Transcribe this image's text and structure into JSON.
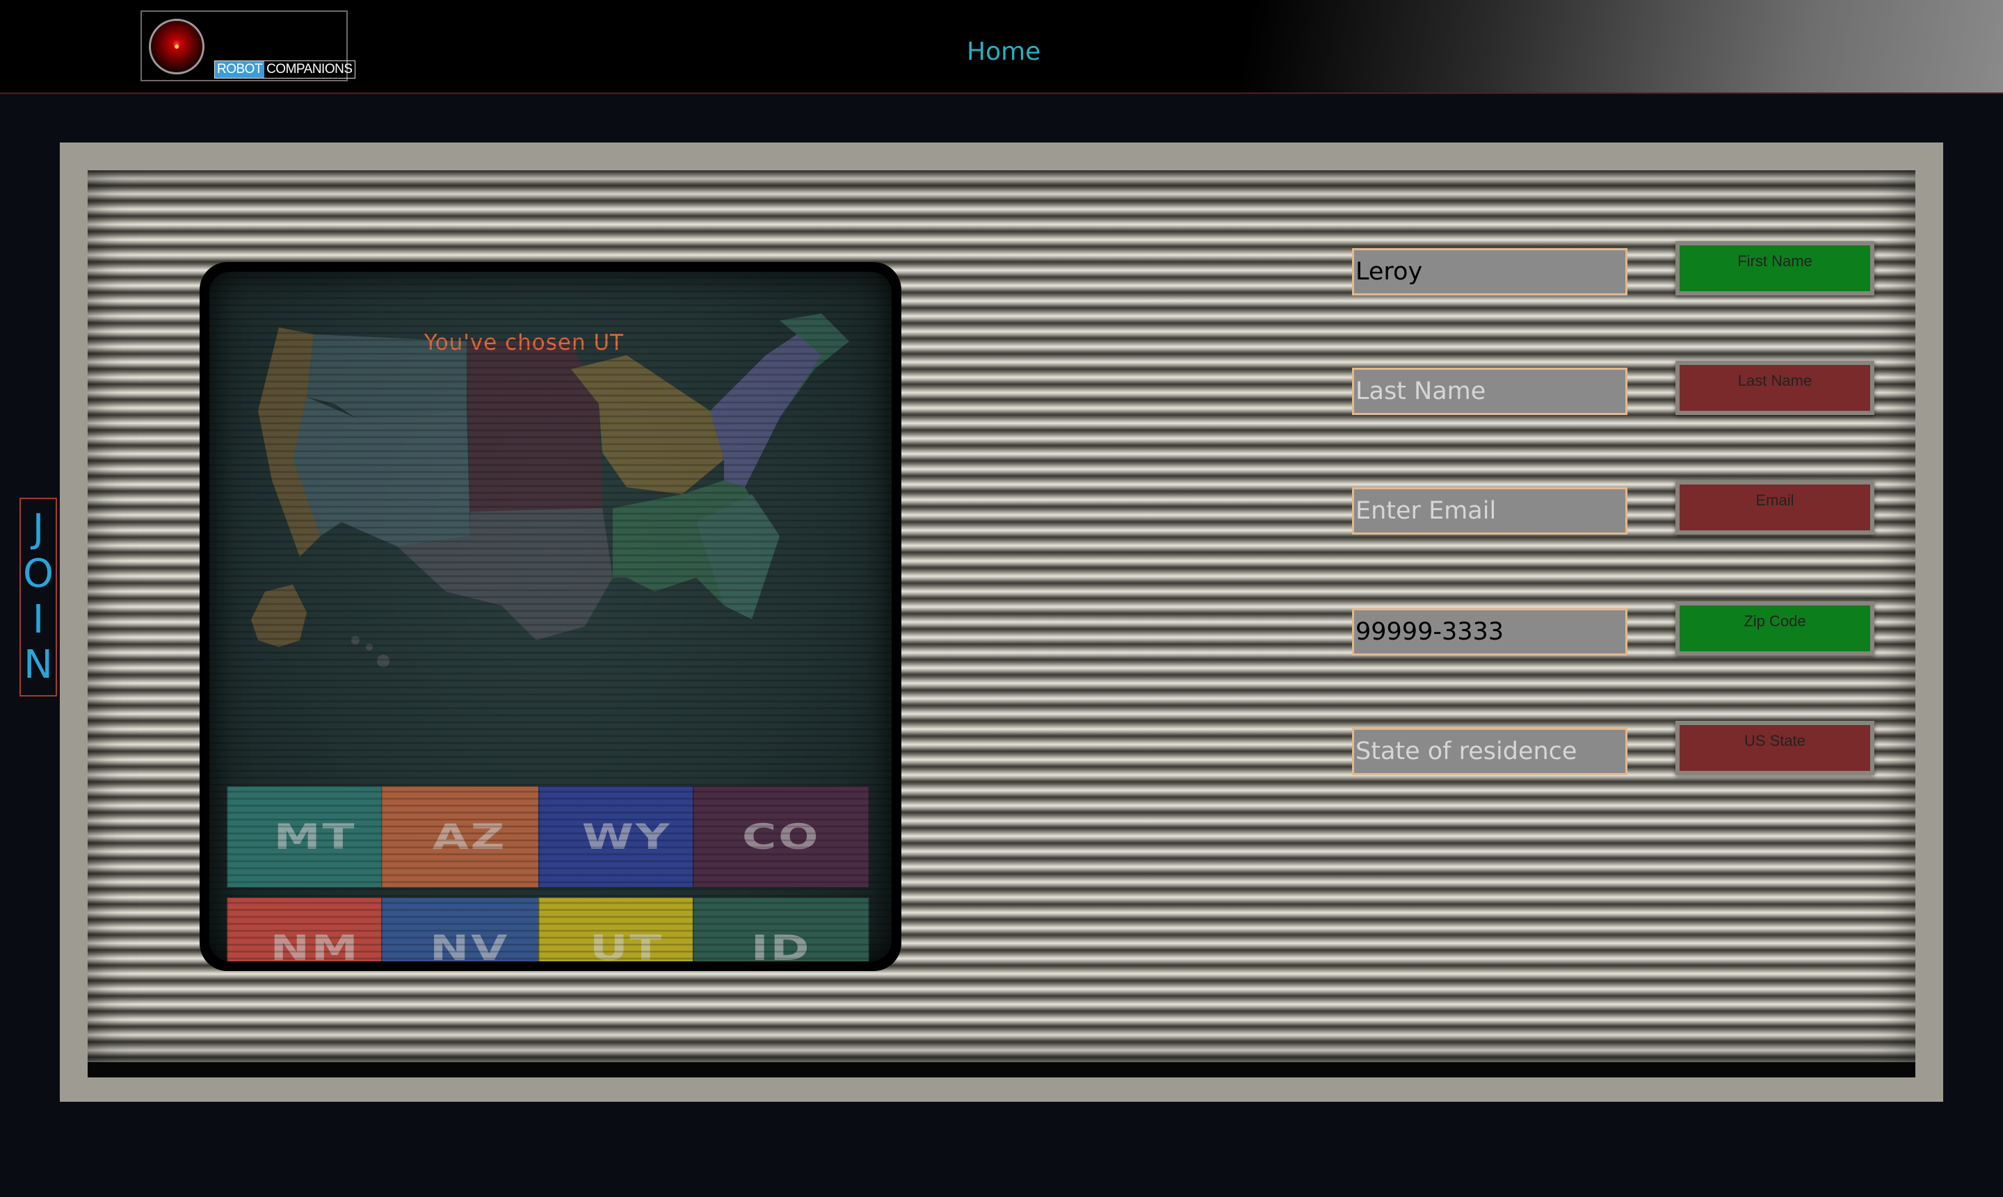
{
  "header": {
    "logo_text_a": "ROBOT",
    "logo_text_b": "COMPANIONS",
    "home_label": "Home"
  },
  "join_tab": {
    "letters": [
      "J",
      "O",
      "I",
      "N"
    ]
  },
  "map": {
    "chosen_text": "You've chosen UT",
    "states": [
      {
        "label": "MT",
        "color": "#2f6f6a"
      },
      {
        "label": "AZ",
        "color": "#a85e3e"
      },
      {
        "label": "WY",
        "color": "#2f3f8a"
      },
      {
        "label": "CO",
        "color": "#4a2c44"
      },
      {
        "label": "NM",
        "color": "#b2473f"
      },
      {
        "label": "NV",
        "color": "#35558a"
      },
      {
        "label": "UT",
        "color": "#b0a323"
      },
      {
        "label": "ID",
        "color": "#2f5a4e"
      }
    ]
  },
  "form": {
    "first_name": {
      "value": "Leroy",
      "placeholder": "First Name",
      "label": "First Name",
      "status_color": "#0d7e1c"
    },
    "last_name": {
      "value": "",
      "placeholder": "Last Name",
      "label": "Last Name",
      "status_color": "#7a2a2b"
    },
    "email": {
      "value": "",
      "placeholder": "Enter Email",
      "label": "Email",
      "status_color": "#7a2a2b"
    },
    "zip": {
      "value": "99999-3333",
      "placeholder": "Zip Code",
      "label": "Zip Code",
      "status_color": "#0d7e1c"
    },
    "state": {
      "value": "",
      "placeholder": "State of residence",
      "label": "US State",
      "status_color": "#7a2a2b"
    }
  }
}
